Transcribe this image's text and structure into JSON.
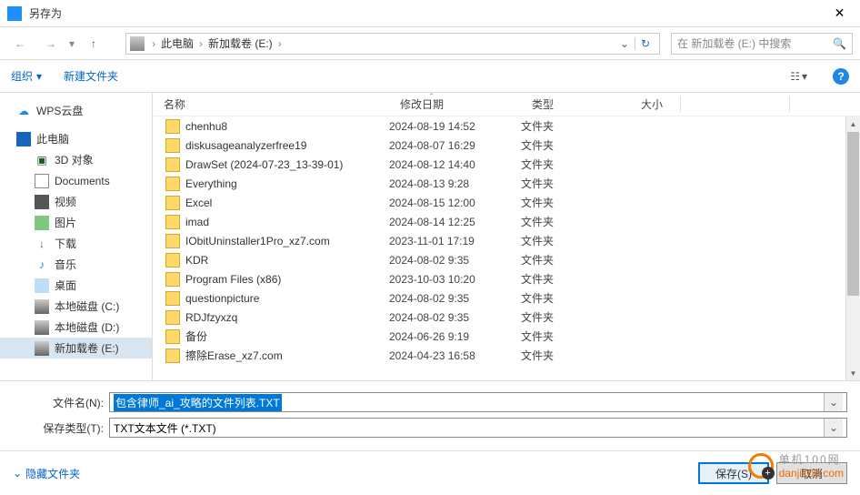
{
  "title": "另存为",
  "breadcrumb": {
    "root": "此电脑",
    "drive": "新加载卷 (E:)"
  },
  "search_placeholder": "在 新加载卷 (E:) 中搜索",
  "toolbar": {
    "organize": "组织",
    "newfolder": "新建文件夹"
  },
  "tree": {
    "cloud": "WPS云盘",
    "pc": "此电脑",
    "items": [
      "3D 对象",
      "Documents",
      "视频",
      "图片",
      "下载",
      "音乐",
      "桌面",
      "本地磁盘 (C:)",
      "本地磁盘 (D:)",
      "新加载卷 (E:)"
    ]
  },
  "columns": {
    "name": "名称",
    "date": "修改日期",
    "type": "类型",
    "size": "大小"
  },
  "type_folder": "文件夹",
  "files": [
    {
      "n": "chenhu8",
      "d": "2024-08-19 14:52"
    },
    {
      "n": "diskusageanalyzerfree19",
      "d": "2024-08-07 16:29"
    },
    {
      "n": "DrawSet (2024-07-23_13-39-01)",
      "d": "2024-08-12 14:40"
    },
    {
      "n": "Everything",
      "d": "2024-08-13 9:28"
    },
    {
      "n": "Excel",
      "d": "2024-08-15 12:00"
    },
    {
      "n": "imad",
      "d": "2024-08-14 12:25"
    },
    {
      "n": "IObitUninstaller1Pro_xz7.com",
      "d": "2023-11-01 17:19"
    },
    {
      "n": "KDR",
      "d": "2024-08-02 9:35"
    },
    {
      "n": "Program Files (x86)",
      "d": "2023-10-03 10:20"
    },
    {
      "n": "questionpicture",
      "d": "2024-08-02 9:35"
    },
    {
      "n": "RDJfzyxzq",
      "d": "2024-08-02 9:35"
    },
    {
      "n": "备份",
      "d": "2024-06-26 9:19"
    },
    {
      "n": "擦除Erase_xz7.com",
      "d": "2024-04-23 16:58"
    }
  ],
  "filename_label": "文件名(N):",
  "filetype_label": "保存类型(T):",
  "filename_value": "包含律师_ai_攻略的文件列表.TXT",
  "filetype_value": "TXT文本文件 (*.TXT)",
  "hide_folders": "隐藏文件夹",
  "save_btn": "保存(S)",
  "cancel_btn": "取消",
  "watermark": {
    "t1": "单机100网",
    "t2": "danji100.com"
  }
}
